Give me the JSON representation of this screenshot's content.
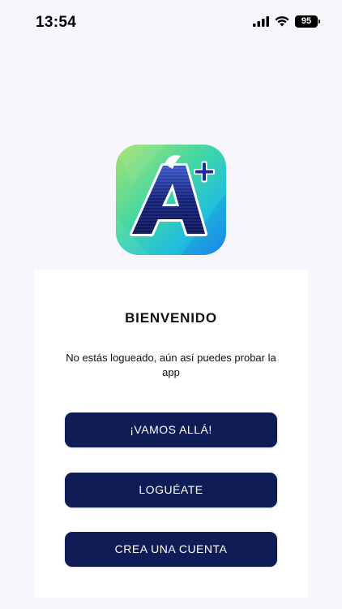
{
  "status_bar": {
    "time": "13:54",
    "battery": "95",
    "icons": [
      "signal-icon",
      "wifi-icon",
      "battery-icon"
    ]
  },
  "logo": {
    "icon": "a-plus-logo-icon"
  },
  "welcome": {
    "title": "BIENVENIDO",
    "subtitle": "No estás logueado, aún así puedes probar la app"
  },
  "actions": {
    "try_label": "¡VAMOS ALLÁ!",
    "login_label": "LOGUÉATE",
    "register_label": "CREA UNA CUENTA"
  },
  "colors": {
    "background": "#f8f6fb",
    "card": "#ffffff",
    "button": "#0f1c55",
    "button_text": "#ffffff"
  }
}
